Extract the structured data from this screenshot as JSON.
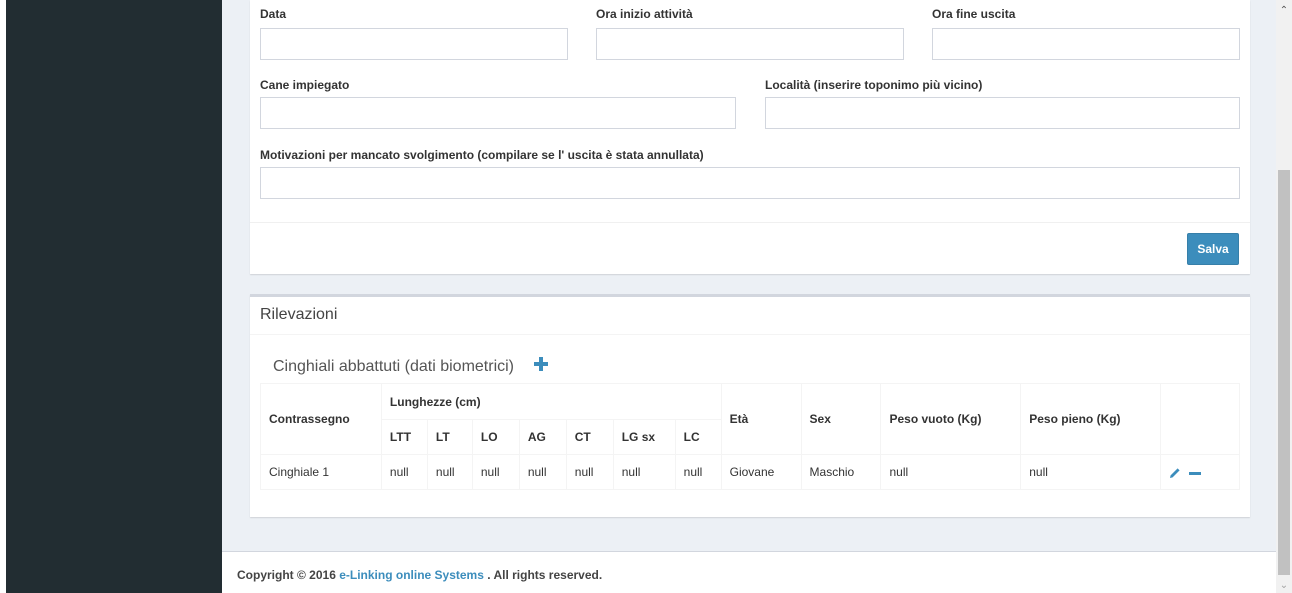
{
  "form": {
    "data_label": "Data",
    "ora_inizio_label": "Ora inizio attività",
    "ora_fine_label": "Ora fine uscita",
    "cane_label": "Cane impiegato",
    "localita_label": "Località (inserire toponimo più vicino)",
    "motivazioni_label": "Motivazioni per mancato svolgimento (compilare se l' uscita è stata annullata)",
    "data_value": "",
    "ora_inizio_value": "",
    "ora_fine_value": "",
    "cane_value": "",
    "localita_value": "",
    "motivazioni_value": "",
    "save_label": "Salva"
  },
  "rilevazioni": {
    "title": "Rilevazioni",
    "subtitle": "Cinghiali abbattuti (dati biometrici)",
    "table": {
      "col_contrassegno": "Contrassegno",
      "col_lunghezze": "Lunghezze (cm)",
      "sub_cols": [
        "LTT",
        "LT",
        "LO",
        "AG",
        "CT",
        "LG sx",
        "LC"
      ],
      "col_eta": "Età",
      "col_sex": "Sex",
      "col_peso_vuoto": "Peso vuoto (Kg)",
      "col_peso_pieno": "Peso pieno (Kg)",
      "rows": [
        {
          "contrassegno": "Cinghiale 1",
          "ltt": "null",
          "lt": "null",
          "lo": "null",
          "ag": "null",
          "ct": "null",
          "lgsx": "null",
          "lc": "null",
          "eta": "Giovane",
          "sex": "Maschio",
          "peso_vuoto": "null",
          "peso_pieno": "null"
        }
      ]
    }
  },
  "footer": {
    "prefix": "Copyright © 2016 ",
    "company": "e-Linking online Systems",
    "suffix": " . All rights reserved."
  },
  "colors": {
    "sidebar": "#222d32",
    "primary": "#3c8dbc",
    "background": "#ecf0f5"
  },
  "icons": {
    "add": "plus-icon",
    "edit": "pencil-icon",
    "remove": "minus-icon",
    "scroll_up": "chevron-up-icon",
    "scroll_down": "chevron-down-icon"
  }
}
